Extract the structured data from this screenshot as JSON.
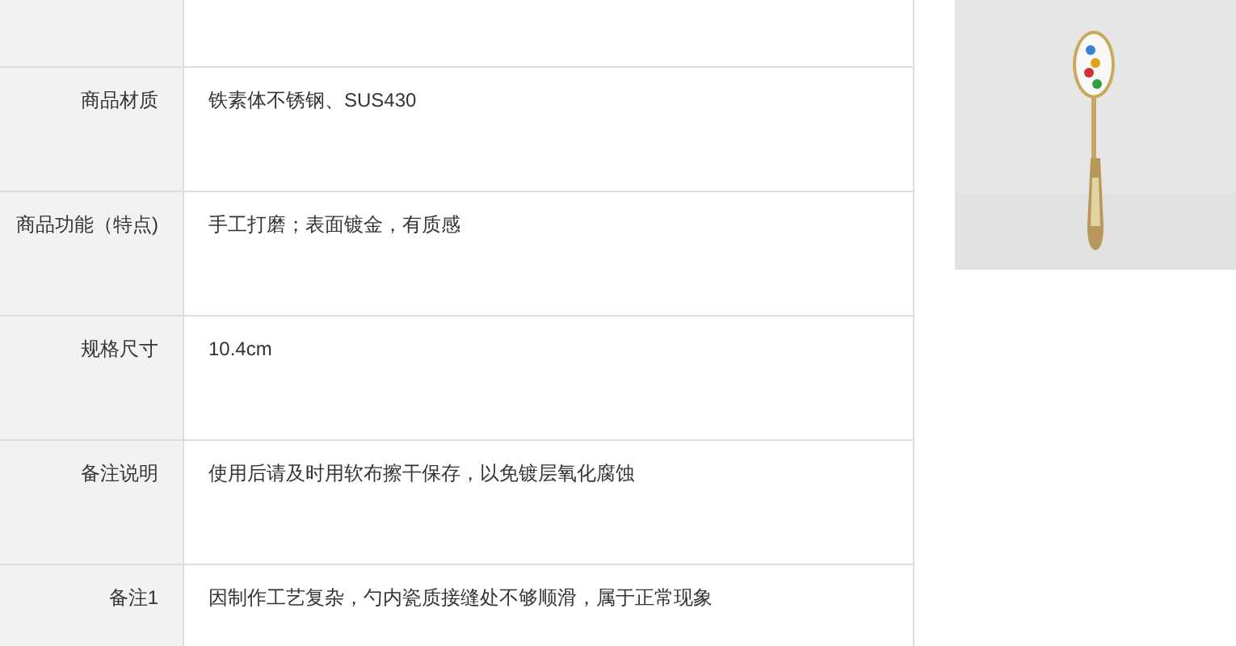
{
  "spec_table": {
    "rows": [
      {
        "label": "商品材质",
        "value": "铁素体不锈钢、SUS430"
      },
      {
        "label": "商品功能（特点)",
        "value": "手工打磨；表面镀金，有质感"
      },
      {
        "label": "规格尺寸",
        "value": "10.4cm"
      },
      {
        "label": "备注说明",
        "value": "使用后请及时用软布擦干保存，以免镀层氧化腐蚀"
      },
      {
        "label": "备注1",
        "value": "因制作工艺复杂，勺内瓷质接缝处不够顺滑，属于正常现象"
      }
    ]
  }
}
